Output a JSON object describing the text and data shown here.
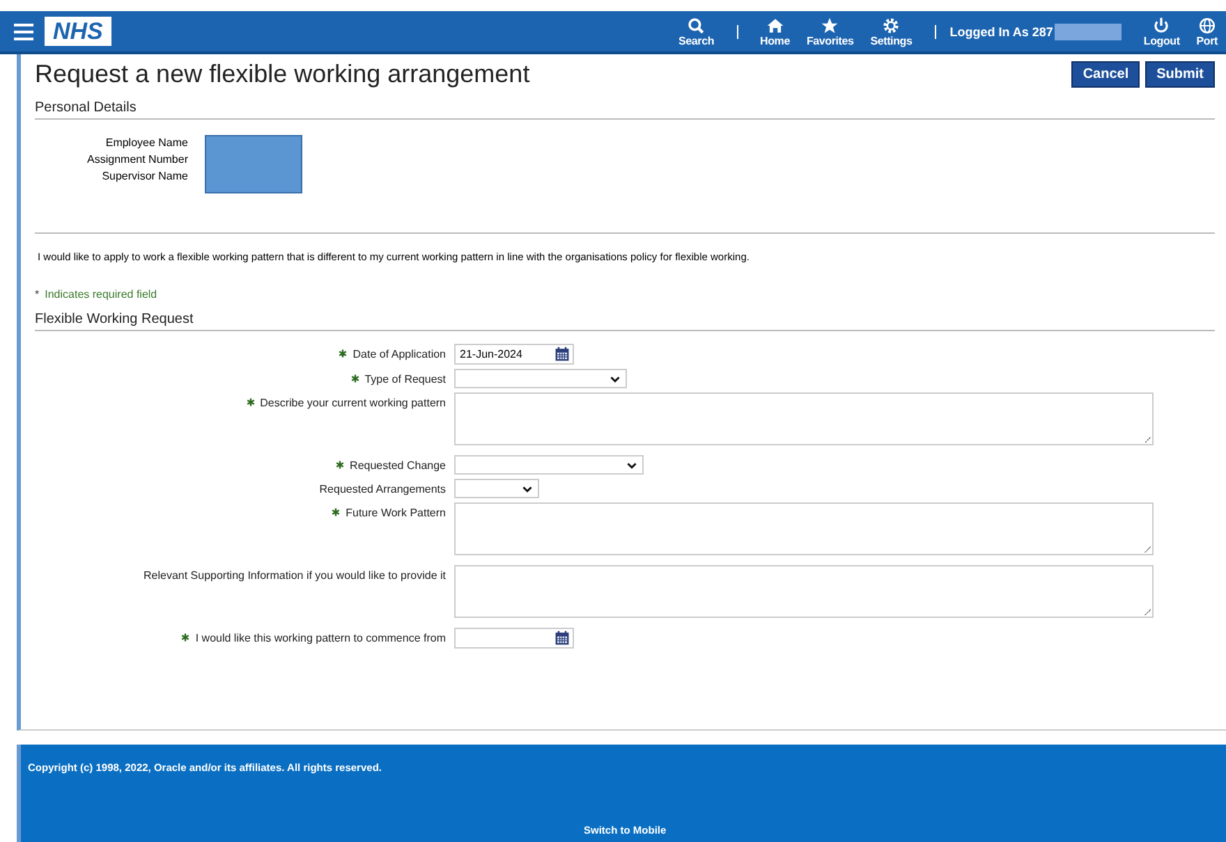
{
  "header": {
    "logo": "NHS",
    "nav": [
      {
        "label": "Search",
        "kind": "search"
      },
      {
        "label": "Home",
        "kind": "home"
      },
      {
        "label": "Favorites",
        "kind": "star"
      },
      {
        "label": "Settings",
        "kind": "gear"
      }
    ],
    "user": "Logged In As 287",
    "nav_right": [
      {
        "label": "Logout",
        "kind": "power"
      },
      {
        "label": "Port",
        "kind": "globe"
      }
    ]
  },
  "page": {
    "title": "Request a new flexible working arrangement",
    "buttons": [
      "Cancel",
      "Submit"
    ]
  },
  "personal_details": {
    "heading": "Personal Details",
    "fields": [
      "Employee Name",
      "Assignment Number",
      "Supervisor Name"
    ]
  },
  "statement": "I would like to apply to work a flexible working pattern that is different to my current working pattern in line with the organisations policy for flexible working.",
  "required_note": {
    "mark": "*",
    "text": "Indicates required field"
  },
  "request": {
    "heading": "Flexible Working Request",
    "fields": [
      {
        "label": "Date of Application",
        "required": true,
        "kind": "date",
        "value": "21-Jun-2024"
      },
      {
        "label": "Type of Request",
        "required": true,
        "kind": "select"
      },
      {
        "label": "Describe your current working pattern",
        "required": true,
        "kind": "textarea"
      },
      {
        "label": "Requested Change",
        "required": true,
        "kind": "select"
      },
      {
        "label": "Requested Arrangements",
        "required": false,
        "kind": "select"
      },
      {
        "label": "Future Work Pattern",
        "required": true,
        "kind": "textarea"
      },
      {
        "label": "Relevant Supporting Information if you would like to provide it",
        "required": false,
        "kind": "textarea"
      },
      {
        "label": "I would like this working pattern to commence from",
        "required": true,
        "kind": "date"
      }
    ]
  },
  "footer": {
    "copyright": "Copyright (c) 1998, 2022, Oracle and/or its affiliates. All rights reserved.",
    "link": "Switch to Mobile"
  }
}
